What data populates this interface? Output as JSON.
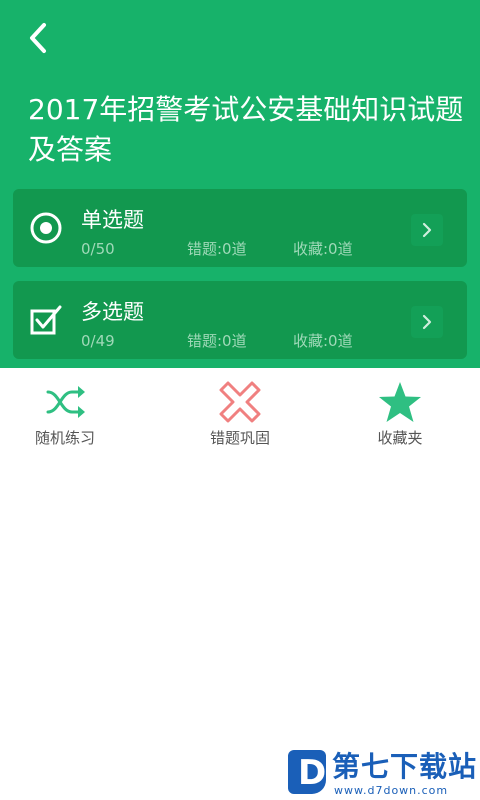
{
  "header": {
    "title": "2017年招警考试公安基础知识试题及答案",
    "background": "#17b26a",
    "back_icon": "chevron-left-icon"
  },
  "categories": [
    {
      "label": "单选题",
      "icon": "radio-target-icon",
      "progress": "0/50",
      "wrong": "错题:0道",
      "favorites": "收藏:0道"
    },
    {
      "label": "多选题",
      "icon": "checkbox-checked-icon",
      "progress": "0/49",
      "wrong": "错题:0道",
      "favorites": "收藏:0道"
    }
  ],
  "toolbar": {
    "items": [
      {
        "label": "随机练习",
        "icon": "shuffle-icon",
        "color": "#2fbf82"
      },
      {
        "label": "错题巩固",
        "icon": "cross-icon",
        "color": "#f08080"
      },
      {
        "label": "收藏夹",
        "icon": "star-icon",
        "color": "#2fbf82"
      }
    ]
  },
  "watermark": {
    "logo_letter": "D",
    "text": "第七下载站",
    "url": "www.d7down.com"
  }
}
